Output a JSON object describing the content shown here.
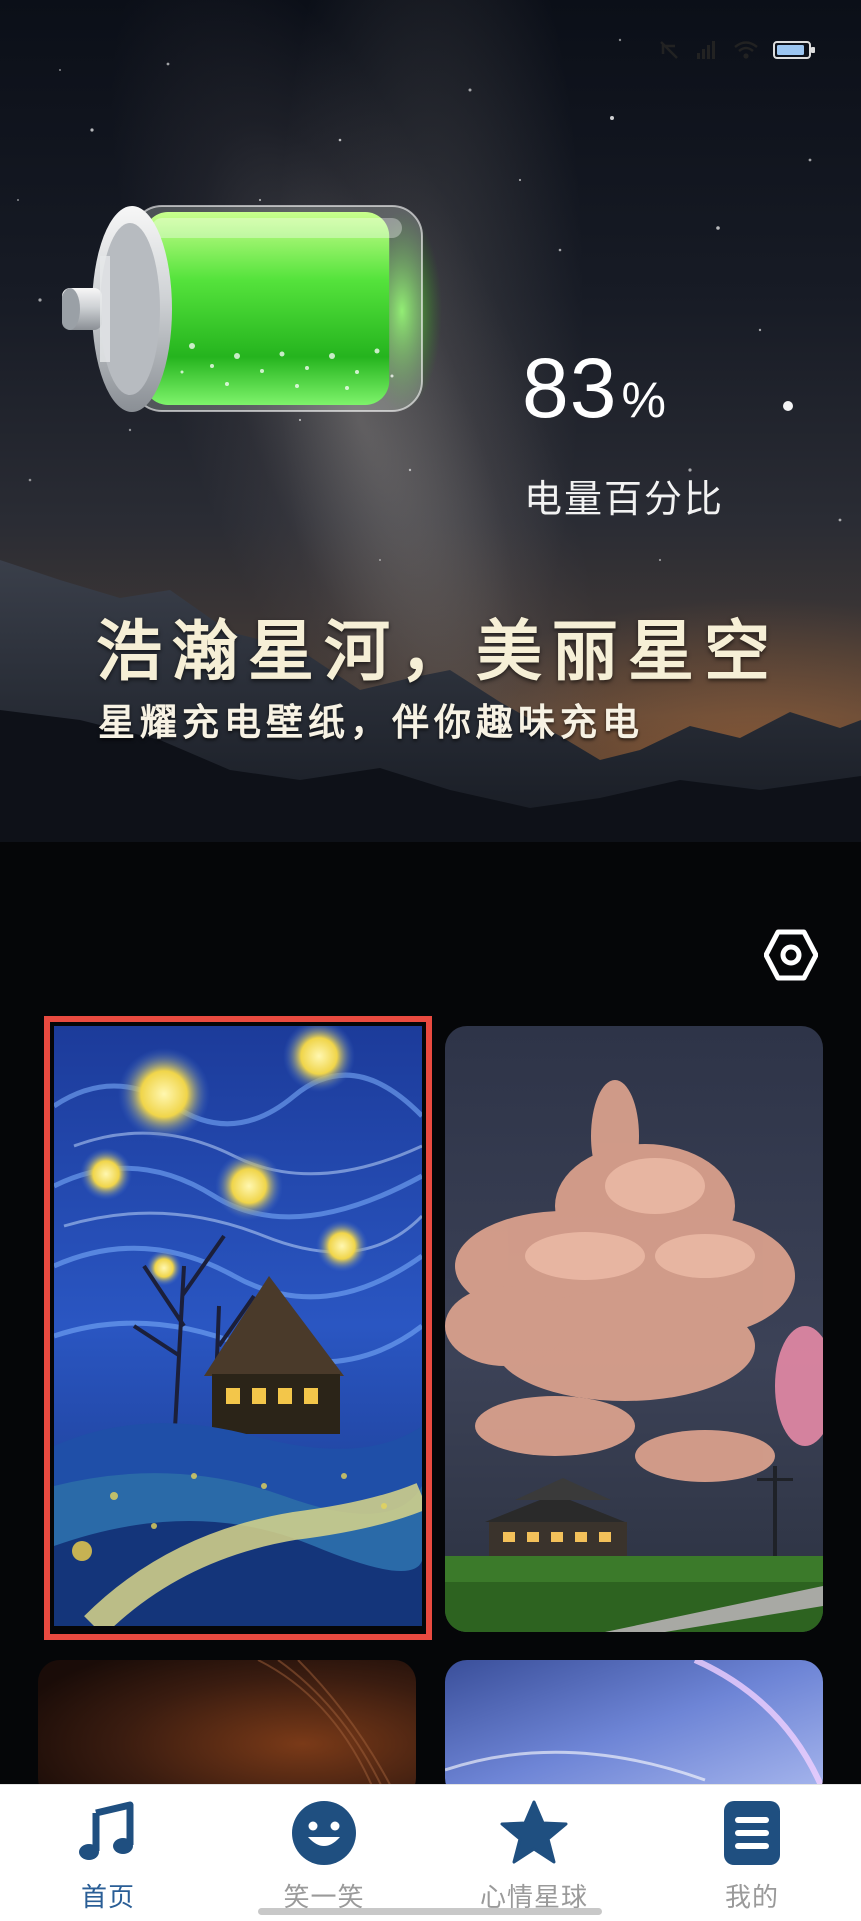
{
  "status_bar": {
    "icons": [
      "mute-icon",
      "signal-icon",
      "wifi-icon",
      "battery-icon"
    ]
  },
  "battery": {
    "level_percent": 83,
    "value": "83",
    "unit": "%",
    "label": "电量百分比"
  },
  "hero": {
    "headline": "浩瀚星河，美丽星空",
    "subheadline": "星耀充电壁纸，伴你趣味充电"
  },
  "wallpapers": [
    {
      "subject": "starry-night-cottage",
      "selected": true
    },
    {
      "subject": "pink-clouds-house"
    },
    {
      "subject": "brown-nebula"
    },
    {
      "subject": "blue-sky-arc"
    }
  ],
  "bottom_nav": {
    "items": [
      {
        "label": "首页",
        "icon": "music-note-icon",
        "active": true
      },
      {
        "label": "笑一笑",
        "icon": "smiley-face-icon"
      },
      {
        "label": "心情星球",
        "icon": "star-icon"
      },
      {
        "label": "我的",
        "icon": "menu-list-icon"
      }
    ]
  },
  "colors": {
    "selection_outline": "#e94a40",
    "nav_active": "#2a5e96",
    "nav_icon": "#1f4f80",
    "battery_fill": "#3fd63a"
  }
}
